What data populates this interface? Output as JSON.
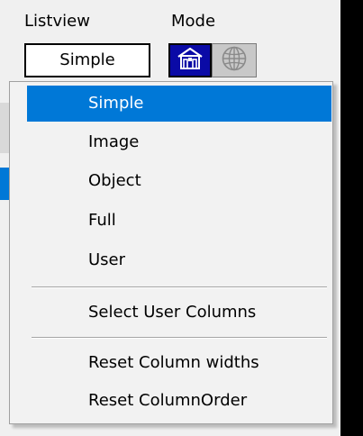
{
  "toolbar": {
    "listview_label": "Listview",
    "mode_label": "Mode",
    "listview_value": "Simple",
    "mode_options": [
      {
        "icon": "house-icon",
        "state": "active"
      },
      {
        "icon": "globe-icon",
        "state": "inactive"
      }
    ]
  },
  "dropdown": {
    "selected": "Simple",
    "items": [
      {
        "label": "Simple"
      },
      {
        "label": "Image"
      },
      {
        "label": "Object"
      },
      {
        "label": "Full"
      },
      {
        "label": "User"
      },
      {
        "label": "Select User Columns"
      },
      {
        "label": "Reset Column widths"
      },
      {
        "label": "Reset ColumnOrder"
      }
    ]
  },
  "colors": {
    "selection": "#0078d7",
    "mode_active_bg": "#0a0aa6",
    "mode_inactive_bg": "#c8c8c8",
    "menu_bg": "#f2f2f2"
  }
}
